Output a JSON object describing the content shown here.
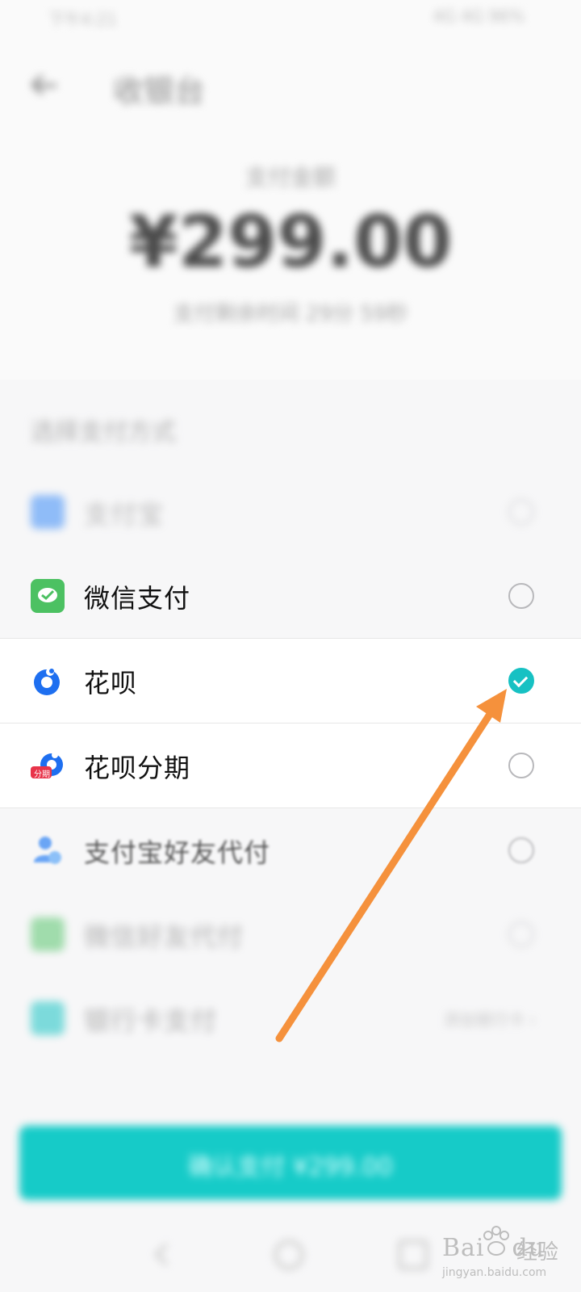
{
  "status_bar": {
    "left": "下午4:21",
    "right": "4G 4G 96%"
  },
  "header": {
    "title": "收银台"
  },
  "payment": {
    "amount_label": "支付金额",
    "amount": "¥299.00",
    "sub": "支付剩余时间 29分 59秒"
  },
  "methods_label": "选择支付方式",
  "methods": [
    {
      "label": "支付宝",
      "icon": "alipay-icon",
      "selected": false
    },
    {
      "label": "微信支付",
      "icon": "wechat-pay-icon",
      "selected": false
    },
    {
      "label": "花呗",
      "icon": "huabei-icon",
      "selected": true
    },
    {
      "label": "花呗分期",
      "icon": "huabei-installment-icon",
      "badge": "分期",
      "selected": false
    },
    {
      "label": "支付宝好友代付",
      "icon": "friend-pay-icon",
      "selected": false
    },
    {
      "label": "微信好友代付",
      "icon": "wechat-friend-pay-icon",
      "selected": false
    },
    {
      "label": "银行卡支付",
      "icon": "bank-card-icon",
      "right": "添加银行卡 ›"
    }
  ],
  "pay_button": {
    "label": "确认支付 ¥299.00"
  },
  "watermark": {
    "logo": "Bai",
    "logo2": "du",
    "cn": "经验",
    "url": "jingyan.baidu.com"
  },
  "colors": {
    "accent": "#17c1c3",
    "arrow": "#f5913c"
  }
}
